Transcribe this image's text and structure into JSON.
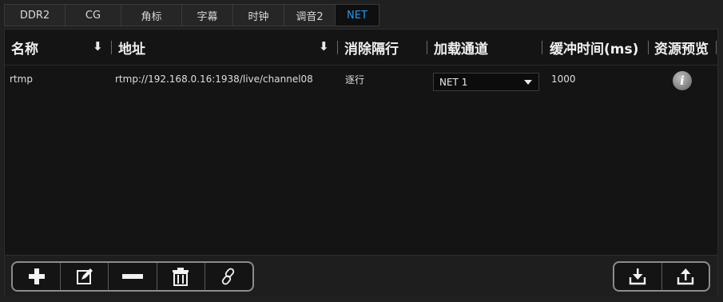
{
  "tabs": [
    {
      "label": "DDR2"
    },
    {
      "label": "CG"
    },
    {
      "label": "角标"
    },
    {
      "label": "字幕"
    },
    {
      "label": "时钟"
    },
    {
      "label": "调音2"
    },
    {
      "label": "NET"
    }
  ],
  "active_tab": "NET",
  "columns": {
    "name": "名称",
    "address": "地址",
    "deinterlace": "消除隔行",
    "load_channel": "加载通道",
    "buffer_time": "缓冲时间(ms)",
    "preview": "资源预览"
  },
  "rows": [
    {
      "name": "rtmp",
      "address": "rtmp://192.168.0.16:1938/live/channel08",
      "deinterlace": "逐行",
      "load_channel": "NET 1",
      "buffer_time": "1000",
      "preview_icon": "info-icon"
    }
  ],
  "toolbar_left": [
    "add-icon",
    "edit-icon",
    "remove-icon",
    "delete-icon",
    "link-icon"
  ],
  "toolbar_right": [
    "import-icon",
    "export-icon"
  ],
  "colors": {
    "accent": "#1d9bf0",
    "background": "#141414"
  }
}
